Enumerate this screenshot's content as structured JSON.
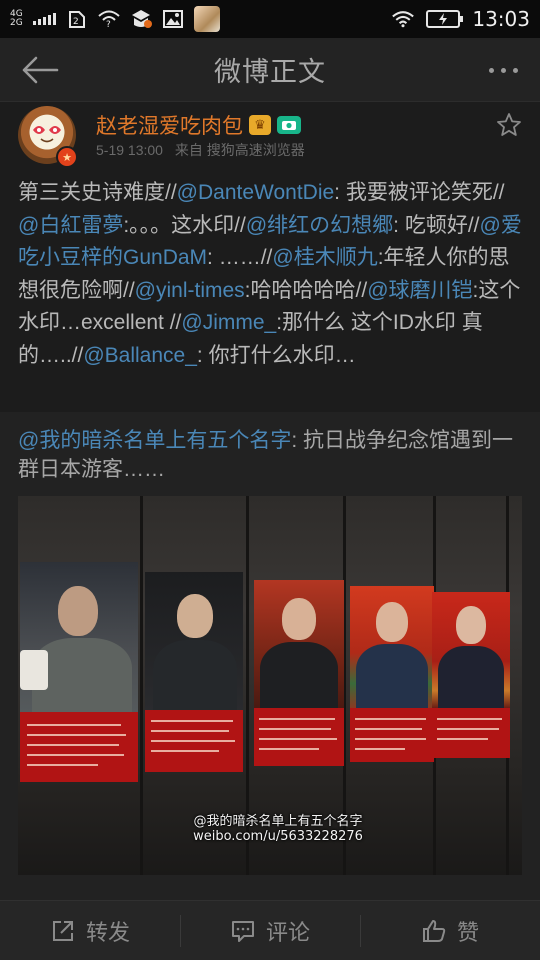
{
  "status_bar": {
    "network_top": "4G",
    "network_bottom": "2G",
    "time": "13:03",
    "icons": [
      "signal-bars-icon",
      "sim-2-icon",
      "wifi-question-icon",
      "notification-app-icon",
      "image-icon",
      "app-avatar-icon",
      "wifi-icon",
      "battery-charging-icon"
    ]
  },
  "header": {
    "title": "微博正文",
    "back_icon": "back-arrow-icon",
    "more_icon": "more-dots-icon"
  },
  "post": {
    "username": "赵老湿爱吃肉包",
    "timestamp": "5-19 13:00",
    "source": "来自 搜狗高速浏览器",
    "segments": [
      {
        "text": "第三关史诗难度//",
        "mention": false
      },
      {
        "text": "@DanteWontDie",
        "mention": true
      },
      {
        "text": ": 我要被评论笑死//",
        "mention": false
      },
      {
        "text": "@白紅雷夢",
        "mention": true
      },
      {
        "text": ":。。。这水印//",
        "mention": false
      },
      {
        "text": "@绯红の幻想郷",
        "mention": true
      },
      {
        "text": ": 吃顿好//",
        "mention": false
      },
      {
        "text": "@爱吃小豆梓的GunDaM",
        "mention": true
      },
      {
        "text": ": ……//",
        "mention": false
      },
      {
        "text": "@桂木顺九",
        "mention": true
      },
      {
        "text": ":年轻人你的思想很危险啊//",
        "mention": false
      },
      {
        "text": "@yinl-times",
        "mention": true
      },
      {
        "text": ":哈哈哈哈哈//",
        "mention": false
      },
      {
        "text": "@球磨川铠",
        "mention": true
      },
      {
        "text": ":这个水印…excellent //",
        "mention": false
      },
      {
        "text": "@Jimme_",
        "mention": true
      },
      {
        "text": ":那什么 这个ID水印 真的…..//",
        "mention": false
      },
      {
        "text": "@Ballance_",
        "mention": true
      },
      {
        "text": ": 你打什么水印…",
        "mention": false
      }
    ]
  },
  "repost": {
    "author_mention": "@我的暗杀名单上有五个名字",
    "text": ": 抗日战争纪念馆遇到一群日本游客……",
    "watermark_line1": "@我的暗杀名单上有五个名字",
    "watermark_line2": "weibo.com/u/5633228276"
  },
  "bottom_bar": {
    "repost_label": "转发",
    "comment_label": "评论",
    "like_label": "赞"
  },
  "colors": {
    "mention": "#4a87b7",
    "username": "#e0782a",
    "background": "#1a1a1a",
    "caption_red": "#b11414"
  }
}
